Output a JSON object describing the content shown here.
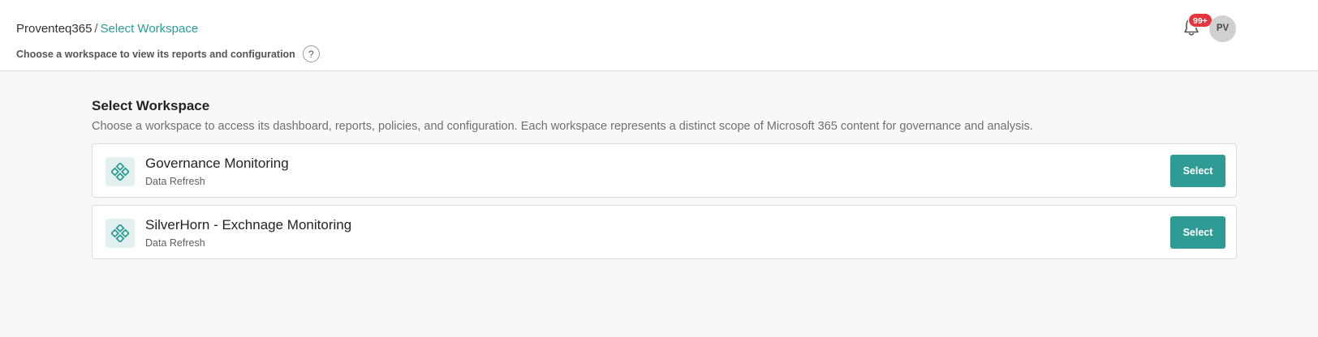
{
  "header": {
    "breadcrumb_root": "Proventeq365",
    "breadcrumb_sep": "/",
    "breadcrumb_current": "Select Workspace",
    "subtitle": "Choose a workspace to view its reports and configuration",
    "help_glyph": "?",
    "notification_badge": "99+",
    "avatar_initials": "PV"
  },
  "main": {
    "title": "Select Workspace",
    "description": "Choose a workspace to access its dashboard, reports, policies, and configuration. Each workspace represents a distinct scope of Microsoft 365 content for governance and analysis.",
    "workspaces": [
      {
        "name": "Governance Monitoring",
        "subtitle": "Data Refresh",
        "button_label": "Select",
        "icon": "workspace-diamonds-icon"
      },
      {
        "name": "SilverHorn - Exchnage Monitoring",
        "subtitle": "Data Refresh",
        "button_label": "Select",
        "icon": "workspace-diamonds-icon"
      }
    ]
  },
  "colors": {
    "accent": "#2e9c94",
    "breadcrumb_active": "#2a9d96",
    "badge": "#e3353b",
    "background": "#f7f8f9"
  }
}
